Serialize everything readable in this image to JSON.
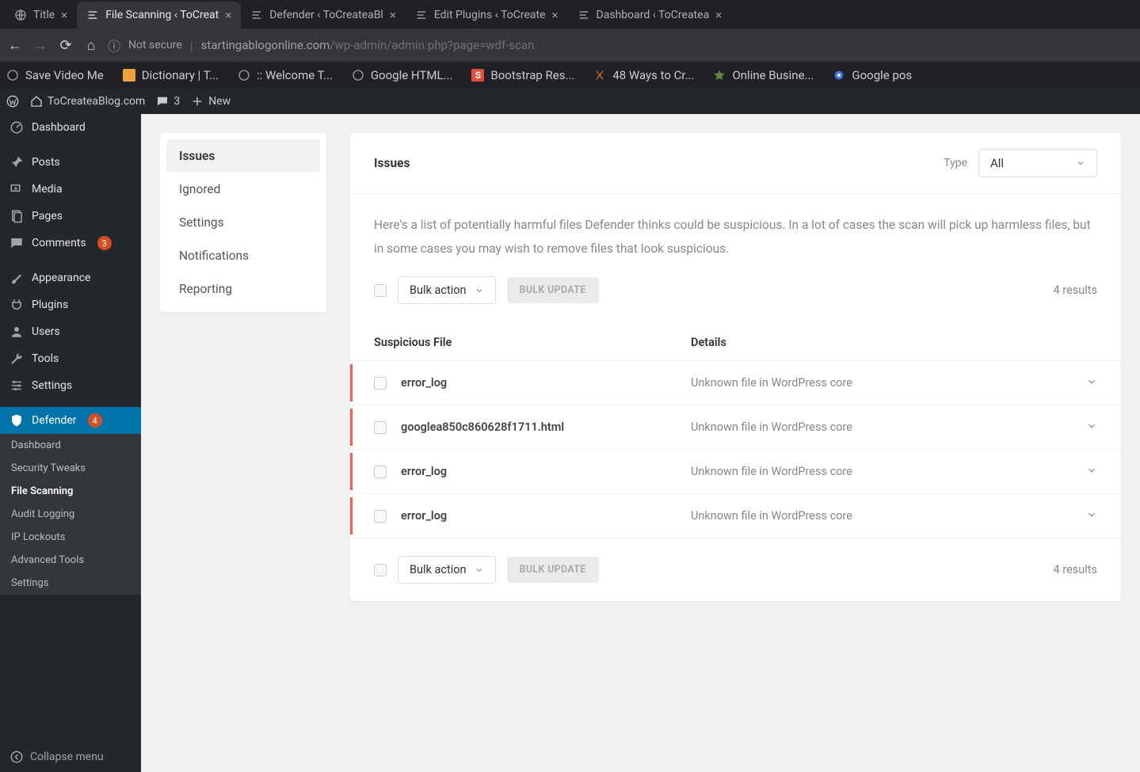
{
  "browser": {
    "tabs": [
      {
        "title": "Title",
        "favicon": "globe"
      },
      {
        "title": "File Scanning ‹ ToCreat",
        "favicon": "defender",
        "active": true
      },
      {
        "title": "Defender ‹ ToCreateaBl",
        "favicon": "defender"
      },
      {
        "title": "Edit Plugins ‹ ToCreate",
        "favicon": "defender"
      },
      {
        "title": "Dashboard ‹ ToCreatea",
        "favicon": "defender"
      }
    ],
    "not_secure": "Not secure",
    "url_host": "startingablogonline.com",
    "url_path": "/wp-admin/admin.php?page=wdf-scan",
    "bookmarks": [
      {
        "label": "Save Video Me",
        "color": "#9aa0a6"
      },
      {
        "label": "Dictionary | T...",
        "color": "#f0a33a"
      },
      {
        "label": ":: Welcome T...",
        "color": "#9aa0a6"
      },
      {
        "label": "Google HTML...",
        "color": "#9aa0a6"
      },
      {
        "label": "Bootstrap Res...",
        "color": "#e44d3a"
      },
      {
        "label": "48 Ways to Cr...",
        "color": "#c06c2a"
      },
      {
        "label": "Online Busine...",
        "color": "#5a8a3a"
      },
      {
        "label": "Google pos",
        "color": "#3b78e7"
      }
    ]
  },
  "wpbar": {
    "site_name": "ToCreateaBlog.com",
    "comments_count": "3",
    "new_label": "New"
  },
  "sidebar": {
    "items": [
      {
        "label": "Dashboard",
        "icon": "dashboard"
      },
      {
        "label": "Posts",
        "icon": "pin"
      },
      {
        "label": "Media",
        "icon": "media"
      },
      {
        "label": "Pages",
        "icon": "pages"
      },
      {
        "label": "Comments",
        "icon": "comment",
        "badge": "3"
      },
      {
        "label": "Appearance",
        "icon": "brush"
      },
      {
        "label": "Plugins",
        "icon": "plug"
      },
      {
        "label": "Users",
        "icon": "user"
      },
      {
        "label": "Tools",
        "icon": "wrench"
      },
      {
        "label": "Settings",
        "icon": "settings"
      },
      {
        "label": "Defender",
        "icon": "shield",
        "badge": "4",
        "active": true
      }
    ],
    "submenu": [
      {
        "label": "Dashboard"
      },
      {
        "label": "Security Tweaks"
      },
      {
        "label": "File Scanning",
        "current": true
      },
      {
        "label": "Audit Logging"
      },
      {
        "label": "IP Lockouts"
      },
      {
        "label": "Advanced Tools"
      },
      {
        "label": "Settings"
      }
    ],
    "collapse_label": "Collapse menu"
  },
  "vtabs": [
    {
      "label": "Issues",
      "active": true
    },
    {
      "label": "Ignored"
    },
    {
      "label": "Settings"
    },
    {
      "label": "Notifications"
    },
    {
      "label": "Reporting"
    }
  ],
  "panel": {
    "title": "Issues",
    "type_label": "Type",
    "type_value": "All",
    "description_a": "Here's a list of potentially harmful files Defender thinks could be suspicious. In a lot of cases the scan will pick up harmless files, but in some cases you may wish to",
    "description_b": "remove files that look suspicious.",
    "bulk_label": "Bulk action",
    "bulk_update": "BULK UPDATE",
    "results_text": "4 results",
    "col_file": "Suspicious File",
    "col_details": "Details",
    "issues": [
      {
        "file": "error_log",
        "detail": "Unknown file in WordPress core"
      },
      {
        "file": "googlea850c860628f1711.html",
        "detail": "Unknown file in WordPress core"
      },
      {
        "file": "error_log",
        "detail": "Unknown file in WordPress core"
      },
      {
        "file": "error_log",
        "detail": "Unknown file in WordPress core"
      }
    ]
  }
}
